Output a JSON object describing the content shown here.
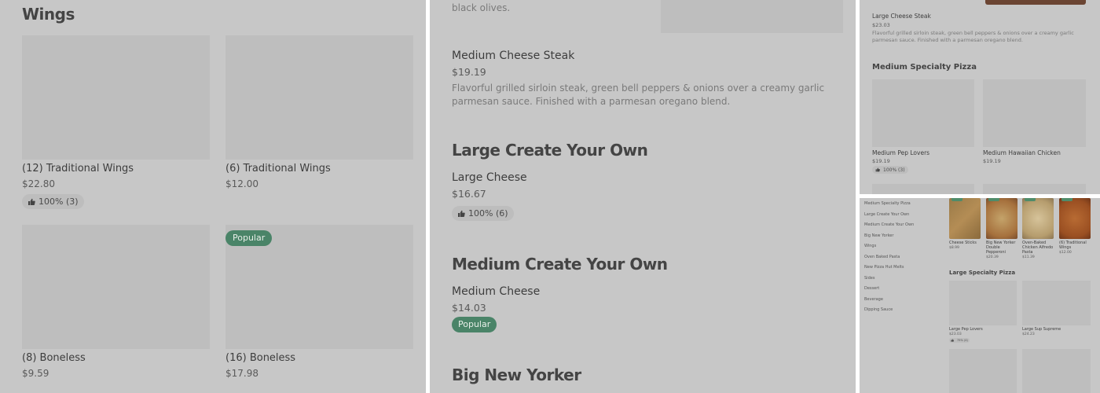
{
  "panel1": {
    "section_title": "Wings",
    "items": [
      {
        "name": "(12) Traditional Wings",
        "price": "$22.80",
        "rating": "100% (3)"
      },
      {
        "name": "(6) Traditional Wings",
        "price": "$12.00"
      },
      {
        "name": "(8) Boneless",
        "price": "$9.59"
      },
      {
        "name": "(16) Boneless",
        "price": "$17.98",
        "badge": "Popular"
      }
    ]
  },
  "panel2": {
    "top_desc_tail": "black olives.",
    "cheese_steak": {
      "name": "Medium Cheese Steak",
      "price": "$19.19",
      "desc": "Flavorful grilled sirloin steak, green bell peppers & onions over a creamy garlic parmesan sauce. Finished with a parmesan oregano blend."
    },
    "large_cyo": {
      "section_title": "Large Create Your Own",
      "name": "Large Cheese",
      "price": "$16.67",
      "rating": "100% (6)"
    },
    "medium_cyo": {
      "section_title": "Medium Create Your Own",
      "name": "Medium Cheese",
      "price": "$14.03",
      "badge": "Popular"
    },
    "big_new_yorker": {
      "section_title": "Big New Yorker"
    }
  },
  "panel3": {
    "large_cheese_steak": {
      "name": "Large Cheese Steak",
      "price": "$23.03",
      "desc": "Flavorful grilled sirloin steak, green bell peppers & onions over a creamy garlic parmesan sauce. Finished with a parmesan oregano blend."
    },
    "section_title": "Medium Specialty Pizza",
    "items": [
      {
        "name": "Medium Pep Lovers",
        "price": "$19.19",
        "rating": "100% (3)"
      },
      {
        "name": "Medium Hawaiian Chicken",
        "price": "$19.19"
      }
    ]
  },
  "panel4": {
    "nav": [
      "Medium Specialty Pizza",
      "Large Create Your Own",
      "Medium Create Your Own",
      "Big New Yorker",
      "Wings",
      "Oven Baked Pasta",
      "New Pizza Hut Melts",
      "Sides",
      "Dessert",
      "Beverage",
      "Dipping Sauce"
    ],
    "featured": [
      {
        "name": "Cheese Sticks",
        "price": "$8.99",
        "icon": "breadsticks"
      },
      {
        "name": "Big New Yorker Double Pepperoni",
        "price": "$20.39",
        "icon": "pizza"
      },
      {
        "name": "Oven-Baked Chicken Alfredo Pasta",
        "price": "$11.39",
        "icon": "pasta"
      },
      {
        "name": "(6) Traditional Wings",
        "price": "$12.00",
        "icon": "wings"
      }
    ],
    "section_title": "Large Specialty Pizza",
    "items": [
      {
        "name": "Large Pep Lovers",
        "price": "$23.03",
        "rating": "75% (4)"
      },
      {
        "name": "Large Sup Supreme",
        "price": "$24.23"
      }
    ]
  },
  "colors": {
    "popular_badge": "#4a8468",
    "overlay": "#c7c7c7"
  }
}
